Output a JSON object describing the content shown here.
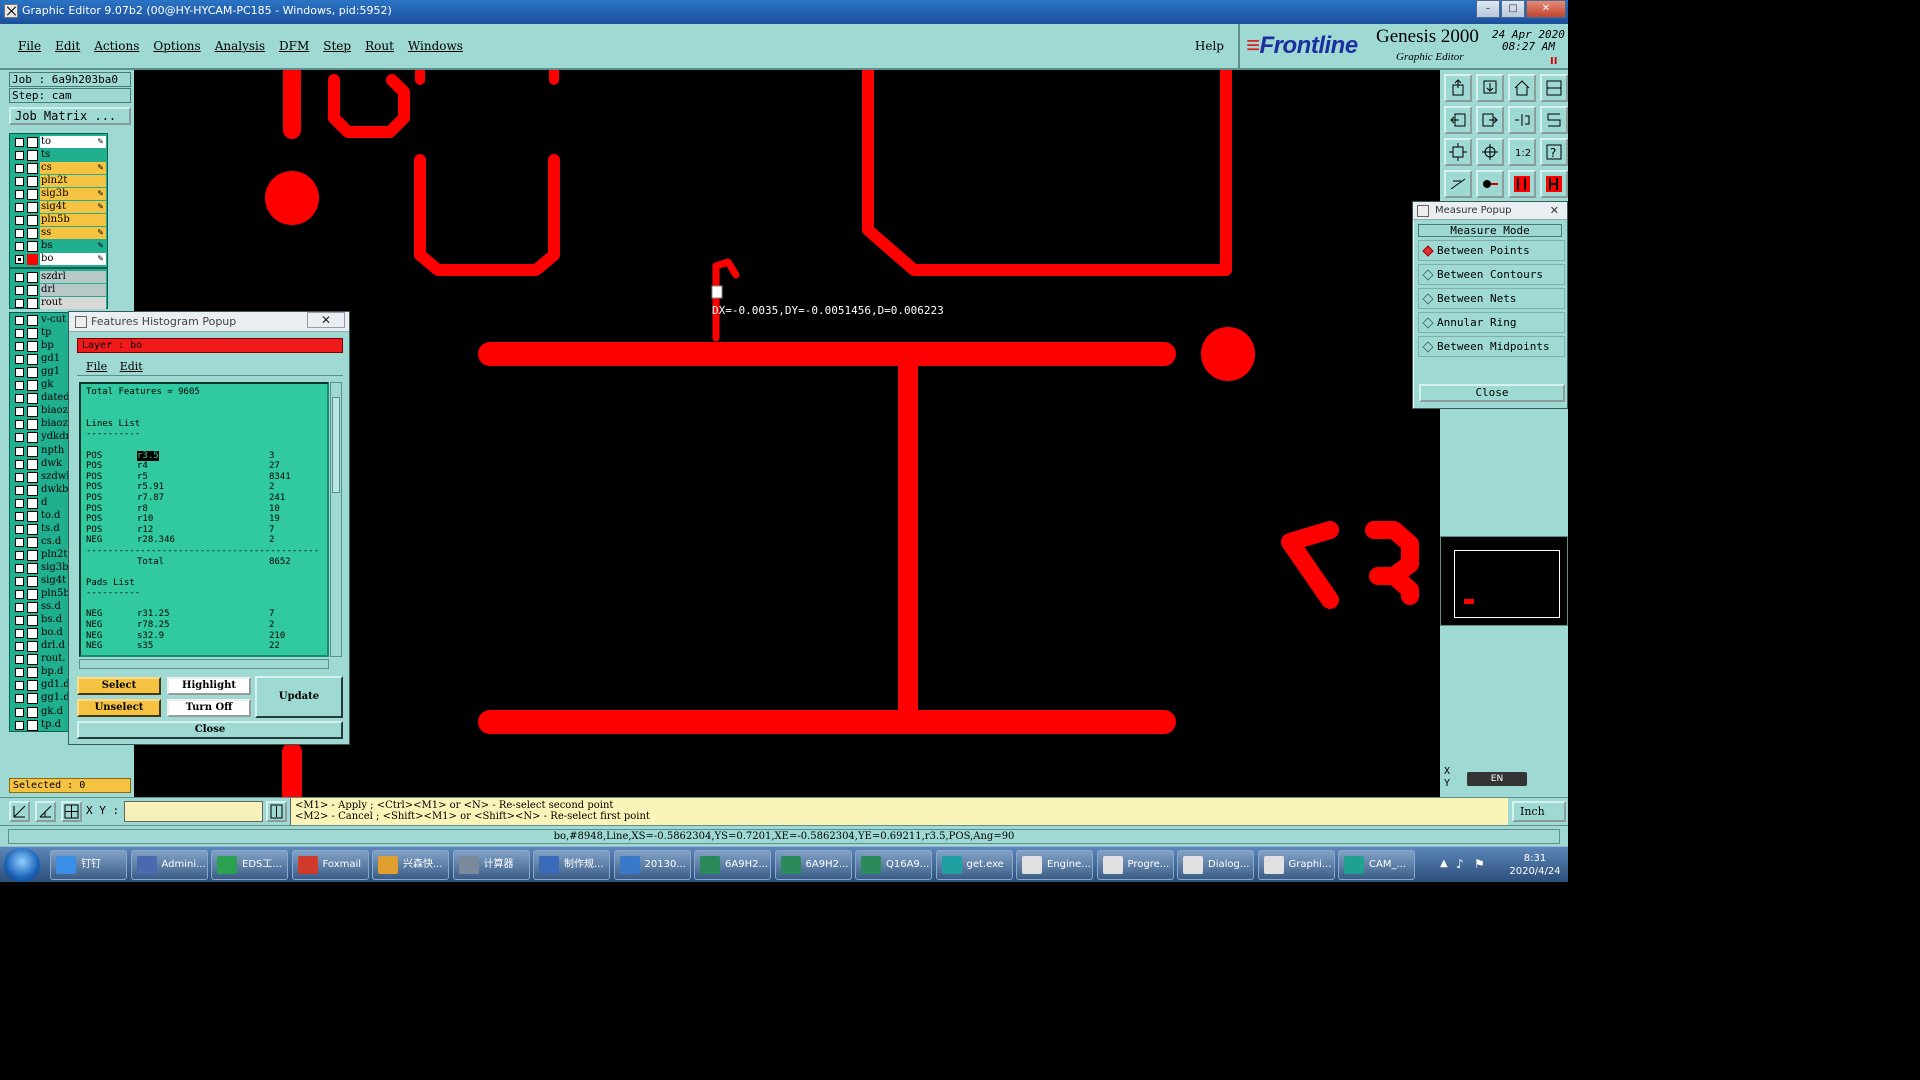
{
  "window": {
    "title": "Graphic Editor 9.07b2 (00@HY-HYCAM-PC185 - Windows, pid:5952)",
    "min_label": "–",
    "max_label": "□",
    "close_label": "✕"
  },
  "menu": [
    "File",
    "Edit",
    "Actions",
    "Options",
    "Analysis",
    "DFM",
    "Step",
    "Rout",
    "Windows"
  ],
  "help_label": "Help",
  "brand": {
    "logo": "Frontline",
    "product": "Genesis 2000",
    "subtitle": "Graphic Editor",
    "date": "24 Apr 2020",
    "time": "08:27 AM",
    "pause_mark": "II"
  },
  "job": {
    "job_line": "Job : 6a9h203ba0",
    "step_line": "Step: cam",
    "matrix_button": "Job Matrix ..."
  },
  "board_layers": [
    {
      "name": "to",
      "color": "#ffffff",
      "edit": true
    },
    {
      "name": "ts",
      "color": "#20b090",
      "edit": false
    },
    {
      "name": "cs",
      "color": "#f5c242",
      "edit": true
    },
    {
      "name": "pln2t",
      "color": "#f5c242",
      "edit": false
    },
    {
      "name": "sig3b",
      "color": "#f5c242",
      "edit": true
    },
    {
      "name": "sig4t",
      "color": "#f5c242",
      "edit": true
    },
    {
      "name": "pln5b",
      "color": "#f5c242",
      "edit": false
    },
    {
      "name": "ss",
      "color": "#f5c242",
      "edit": true
    },
    {
      "name": "bs",
      "color": "#20b090",
      "edit": true
    },
    {
      "name": "bo",
      "color": "#ffffff",
      "edit": true,
      "active": true
    }
  ],
  "drill_layers": [
    {
      "name": "szdrl",
      "color": "#b8c8c8"
    },
    {
      "name": "drl",
      "color": "#b8c8c8"
    },
    {
      "name": "rout",
      "color": "#d8d8d8"
    }
  ],
  "misc_layers": [
    "v-cut",
    "tp",
    "bp",
    "gd1",
    "gg1",
    "gk",
    "dated",
    "biaoz",
    "biaoz",
    "ydkdr",
    "npth",
    "dwk",
    "szdwk",
    "dwkby",
    "d",
    "to.d",
    "ts.d",
    "cs.d",
    "pln2t",
    "sig3b",
    "sig4t",
    "pln5b",
    "ss.d",
    "bs.d",
    "bo.d",
    "drl.d",
    "rout.",
    "bp.d",
    "gd1.d",
    "gg1.d",
    "gk.d",
    "tp.d"
  ],
  "selected_label": "Selected : 0",
  "measure_readout": "DX=-0.0035,DY=-0.0051456,D=0.006223",
  "measure_popup": {
    "title": "Measure Popup",
    "header": "Measure Mode",
    "options": [
      {
        "label": "Between Points",
        "selected": true
      },
      {
        "label": "Between Contours",
        "selected": false
      },
      {
        "label": "Between Nets",
        "selected": false
      },
      {
        "label": "Annular Ring",
        "selected": false
      },
      {
        "label": "Between Midpoints",
        "selected": false
      }
    ],
    "close": "Close"
  },
  "histogram": {
    "title": "Features Histogram Popup",
    "close_x": "✕",
    "layer_label": "Layer :  bo",
    "menu": [
      "File",
      "Edit"
    ],
    "total_line": "Total Features = 9605",
    "lines_title": "Lines List",
    "rule": "----------",
    "lines": [
      {
        "pol": "POS",
        "sym": "r3.5",
        "count": "3"
      },
      {
        "pol": "POS",
        "sym": "r4",
        "count": "27"
      },
      {
        "pol": "POS",
        "sym": "r5",
        "count": "8341"
      },
      {
        "pol": "POS",
        "sym": "r5.91",
        "count": "2"
      },
      {
        "pol": "POS",
        "sym": "r7.87",
        "count": "241"
      },
      {
        "pol": "POS",
        "sym": "r8",
        "count": "10"
      },
      {
        "pol": "POS",
        "sym": "r10",
        "count": "19"
      },
      {
        "pol": "POS",
        "sym": "r12",
        "count": "7"
      },
      {
        "pol": "NEG",
        "sym": "r28.346",
        "count": "2"
      }
    ],
    "total_rule": "-------------------------------------------",
    "total_label": "Total",
    "total_value": "8652",
    "pads_title": "Pads List",
    "pads": [
      {
        "pol": "NEG",
        "sym": "r31.25",
        "count": "7"
      },
      {
        "pol": "NEG",
        "sym": "r78.25",
        "count": "2"
      },
      {
        "pol": "NEG",
        "sym": "s32.9",
        "count": "210"
      },
      {
        "pol": "NEG",
        "sym": "s35",
        "count": "22"
      }
    ],
    "buttons": {
      "select": "Select",
      "unselect": "Unselect",
      "highlight": "Highlight",
      "turn_off": "Turn Off",
      "update": "Update",
      "close": "Close"
    }
  },
  "command": {
    "xy_label": "X Y :",
    "xy_value": "",
    "hint_line1": "<M1> - Apply  ; <Ctrl><M1> or <N> - Re-select second point",
    "hint_line2": "<M2> - Cancel ; <Shift><M1> or <Shift><N> - Re-select first point",
    "unit": "Inch"
  },
  "status_line": "bo,#8948,Line,XS=-0.5862304,YS=0.7201,XE=-0.5862304,YE=0.69211,r3.5,POS,Ang=90",
  "coords": {
    "x_label": "X",
    "y_label": "Y"
  },
  "taskbar": {
    "tasks": [
      "钉钉",
      "Admini...",
      "EDS工...",
      "Foxmail",
      "兴森快...",
      "计算器",
      "制作规...",
      "20130...",
      "6A9H2...",
      "6A9H2...",
      "Q16A9...",
      "get.exe",
      "Engine...",
      "Progre...",
      "Dialog...",
      "Graphi...",
      "CAM_..."
    ],
    "clock_time": "8:31",
    "clock_date": "2020/4/24",
    "lang": "EN"
  },
  "colors": {
    "panel": "#9fd9d4",
    "feature_red": "#ff0000",
    "layer_green": "#20b090",
    "layer_yellow": "#f5c242"
  }
}
